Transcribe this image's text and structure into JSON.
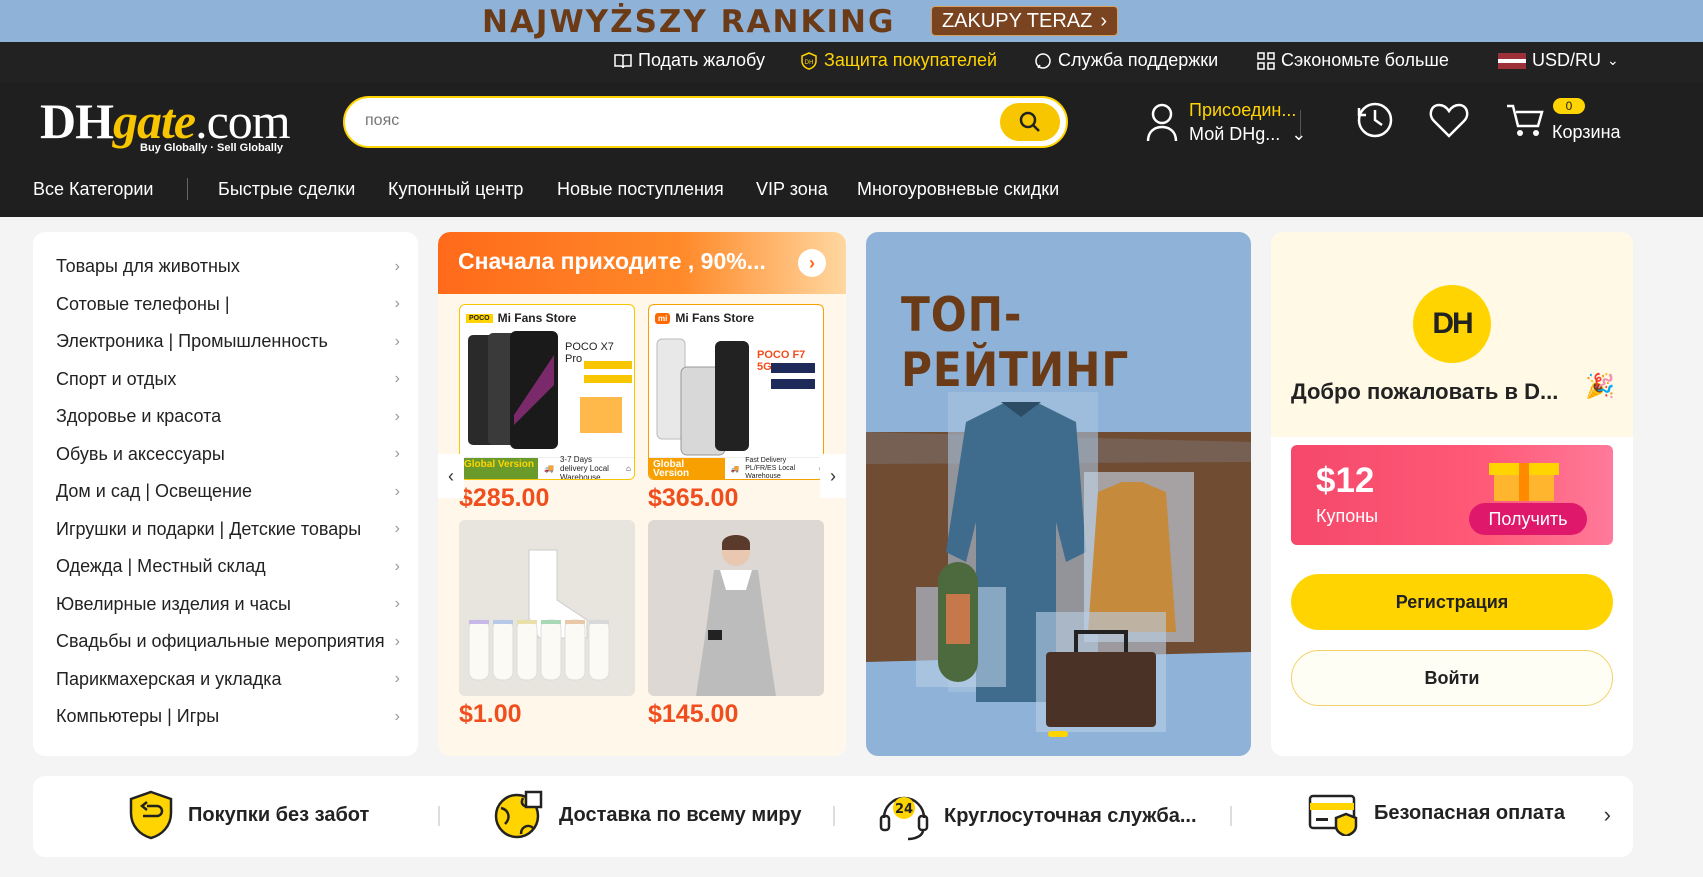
{
  "promo_banner": {
    "title": "NAJWYŻSZY RANKING",
    "button_label": "ZAKUPY TERAZ"
  },
  "topbar": {
    "complaint": "Подать жалобу",
    "protection": "Защита покупателей",
    "support": "Служба поддержки",
    "save_more": "Сэкономьте больше",
    "currency": "USD/RU"
  },
  "header": {
    "logo_main_a": "DH",
    "logo_main_b": "gate",
    "logo_main_c": ".com",
    "logo_tagline": "Buy Globally · Sell Globally",
    "search_placeholder": "пояс",
    "account_line1": "Присоедин...",
    "account_line2": "Мой DHg...",
    "cart_count": "0",
    "cart_label": "Корзина"
  },
  "nav": {
    "all_categories": "Все Категории",
    "items": [
      "Быстрые сделки",
      "Купонный центр",
      "Новые поступления",
      "VIP зона",
      "Многоуровневые скидки"
    ]
  },
  "categories": [
    "Товары для животных",
    "Сотовые телефоны |",
    "Электроника | Промышленность",
    "Спорт и отдых",
    "Здоровье и красота",
    "Обувь и аксессуары",
    "Дом и сад | Освещение",
    "Игрушки и подарки | Детские товары",
    "Одежда | Местный склад",
    "Ювелирные изделия и часы",
    "Свадьбы и официальные мероприятия",
    "Парикмахерская и укладка",
    "Компьютеры | Игры"
  ],
  "deals": {
    "title": "Сначала приходите , 90%...",
    "products": [
      {
        "store": "Mi Fans Store",
        "model": "POCO X7 Pro",
        "price": "$285.00",
        "badge": "Global Version",
        "delivery": "3-7 Days delivery Local Warehouse"
      },
      {
        "store": "Mi Fans Store",
        "model": "POCO F7 5G",
        "price": "$365.00",
        "badge": "Global Version",
        "delivery": "Fast Delivery PL/FR/ES Local Warehouse"
      },
      {
        "price": "$1.00"
      },
      {
        "price": "$145.00"
      }
    ]
  },
  "banner": {
    "title": "ТОП-РЕЙТИНГ"
  },
  "welcome": {
    "logo": "DH",
    "greeting": "Добро пожаловать в D...",
    "coupon_amount": "$12",
    "coupon_label": "Купоны",
    "coupon_button": "Получить",
    "register": "Регистрация",
    "login": "Войти"
  },
  "features": [
    "Покупки без забот",
    "Доставка по всему миру",
    "Круглосуточная служба...",
    "Безопасная оплата"
  ],
  "colors": {
    "accent": "#ffd400",
    "header_bg": "#1f1f1f",
    "price": "#f04e1d",
    "coupon": "#f5486b"
  }
}
